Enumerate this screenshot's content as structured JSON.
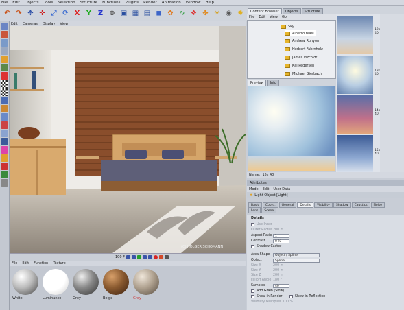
{
  "menubar": [
    "File",
    "Edit",
    "Objects",
    "Tools",
    "Selection",
    "Structure",
    "Functions",
    "Plugins",
    "Render",
    "Animation",
    "Window",
    "Help"
  ],
  "viewport": {
    "menu": [
      "Edit",
      "Cameras",
      "Display",
      "View"
    ],
    "credit": "(C) HOLGER SCHOMANN"
  },
  "timeline": {
    "frame": "100 F"
  },
  "material_manager": {
    "menu": [
      "File",
      "Edit",
      "Function",
      "Texture"
    ],
    "materials": [
      {
        "name": "White",
        "color": "#d0d0d0"
      },
      {
        "name": "Luminance",
        "color": "#ffffff"
      },
      {
        "name": "Grey",
        "color": "#9a9a9a"
      },
      {
        "name": "Beige",
        "color": "#8a5a30"
      },
      {
        "name": "Grey",
        "color": "#b0a290"
      }
    ]
  },
  "content_browser": {
    "tabs": [
      "Content Browser",
      "Objects",
      "Structure"
    ],
    "menu": [
      "File",
      "Edit",
      "View",
      "Go"
    ],
    "tree_root": "Sky",
    "tree_items": [
      "Alberto Blasi",
      "Andrew Runyon",
      "Herbert Fahrnholz",
      "James Vizcoldt",
      "Kai Pedersen",
      "Michael Gierbach"
    ],
    "preview_tabs": [
      "Preview",
      "Info"
    ],
    "name_label": "Name:",
    "name_value": "15s 40",
    "thumbnails": [
      "12s 40",
      "13s 40",
      "14s 40",
      "15s 40"
    ]
  },
  "attribute_manager": {
    "title": "Attributes",
    "menu": [
      "Mode",
      "Edit",
      "User Data"
    ],
    "object_title": "Light Object [Light]",
    "tabs_row1": [
      "Basic",
      "Coord.",
      "General",
      "Details",
      "Visibility",
      "Shadow",
      "Caustics",
      "Noise"
    ],
    "tabs_row2": [
      "Lens",
      "Scene"
    ],
    "active_tab": "Details",
    "section": "Details",
    "fields": {
      "use_inner": "Use Inner",
      "outer_radius_label": "Outer Radius",
      "outer_radius": "200 m",
      "aspect_ratio_label": "Aspect Ratio",
      "aspect_ratio": "1",
      "contrast_label": "Contrast",
      "contrast": "0 %",
      "shadow_caster": "Shadow Caster",
      "area_shape_label": "Area Shape",
      "area_shape": "Object / Spline",
      "object_label": "Object",
      "object_value": "Spline",
      "size_x_label": "Size X",
      "size_x": "200 m",
      "size_y_label": "Size Y",
      "size_y": "200 m",
      "size_z_label": "Size Z",
      "size_z": "200 m",
      "falloff_angle_label": "Falloff Angle",
      "falloff_angle": "180 °",
      "samples_label": "Samples",
      "samples": "40",
      "add_grain": "Add Grain (Slow)",
      "show_in_render": "Show in Render",
      "show_in_reflection": "Show in Reflection",
      "visibility_multiplier_label": "Visibility Multiplier",
      "visibility_multiplier": "100 %"
    }
  }
}
